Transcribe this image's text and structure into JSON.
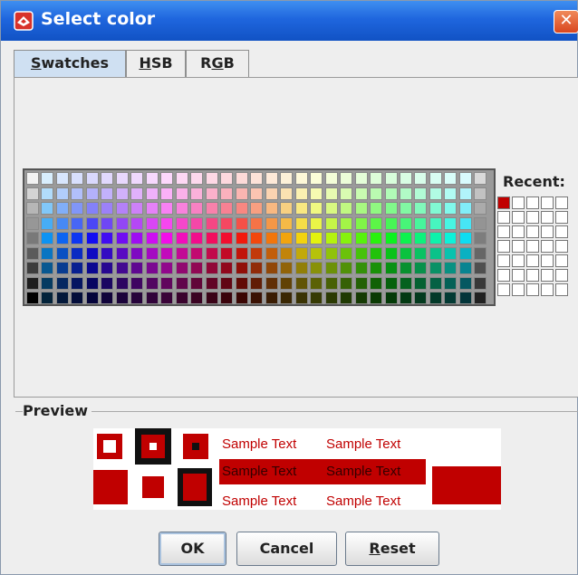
{
  "window": {
    "title": "Select color"
  },
  "tabs": [
    {
      "pre": "",
      "mn": "S",
      "post": "watches",
      "selected": true
    },
    {
      "pre": "",
      "mn": "H",
      "post": "SB",
      "selected": false
    },
    {
      "pre": "R",
      "mn": "G",
      "post": "B",
      "selected": false
    }
  ],
  "recent": {
    "label": "Recent:",
    "selected_color": "#c00000"
  },
  "preview": {
    "label": "Preview",
    "sample_text": "Sample Text",
    "color": "#c00000"
  },
  "buttons": {
    "ok": "OK",
    "cancel": "Cancel",
    "reset": {
      "pre": "",
      "mn": "R",
      "post": "eset"
    }
  },
  "swatches": {
    "columns": 31,
    "rows": 9
  }
}
